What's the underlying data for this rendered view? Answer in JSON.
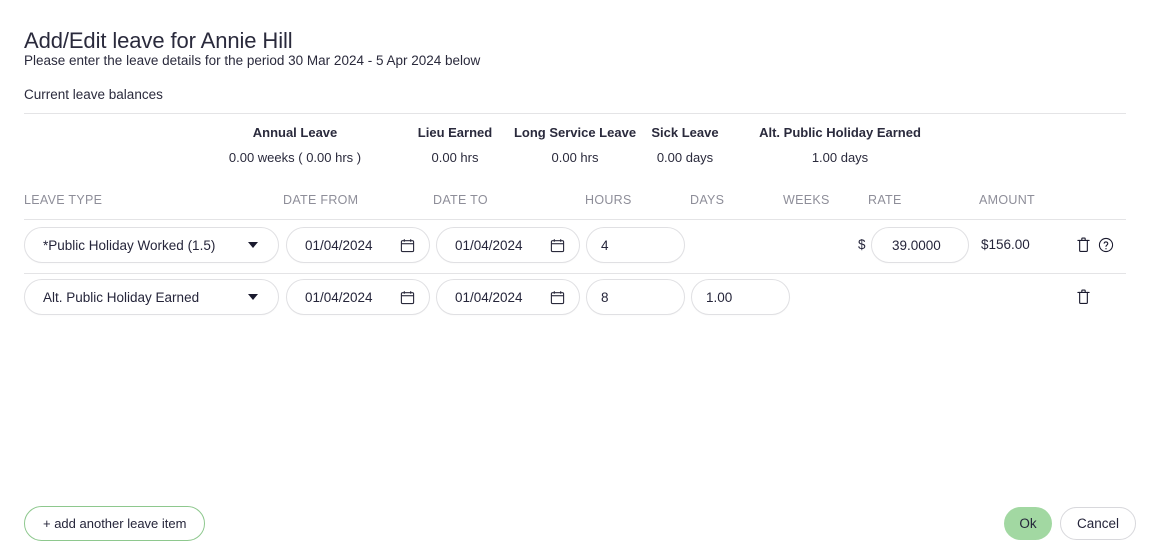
{
  "header": {
    "title": "Add/Edit leave for Annie Hill",
    "subtitle": "Please enter the leave details for the period 30 Mar 2024 - 5 Apr 2024 below",
    "balances_title": "Current leave balances"
  },
  "balances": [
    {
      "label": "Annual Leave",
      "value": "0.00 weeks ( 0.00 hrs )"
    },
    {
      "label": "Lieu Earned",
      "value": "0.00 hrs"
    },
    {
      "label": "Long Service Leave",
      "value": "0.00 hrs"
    },
    {
      "label": "Sick Leave",
      "value": "0.00 days"
    },
    {
      "label": "Alt. Public Holiday Earned",
      "value": "1.00 days"
    }
  ],
  "table": {
    "columns": {
      "leave_type": "LEAVE TYPE",
      "date_from": "DATE FROM",
      "date_to": "DATE TO",
      "hours": "HOURS",
      "days": "DAYS",
      "weeks": "WEEKS",
      "rate": "RATE",
      "amount": "AMOUNT"
    },
    "rows": [
      {
        "leave_type": "*Public Holiday Worked (1.5)",
        "date_from": "01/04/2024",
        "date_to": "01/04/2024",
        "hours": "4",
        "days": "",
        "weeks": "",
        "currency_symbol": "$",
        "rate": "39.0000",
        "amount": "$156.00",
        "delete_icon": "trash-icon",
        "help_icon": "help-circle-icon"
      },
      {
        "leave_type": "Alt. Public Holiday Earned",
        "date_from": "01/04/2024",
        "date_to": "01/04/2024",
        "hours": "8",
        "days": "1.00",
        "weeks": "",
        "currency_symbol": "",
        "rate": "",
        "amount": "",
        "delete_icon": "trash-icon",
        "help_icon": ""
      }
    ]
  },
  "footer": {
    "add_label": "+ add another leave item",
    "ok_label": "Ok",
    "cancel_label": "Cancel"
  },
  "colors": {
    "accent_green": "#a2d8a2",
    "add_border_green": "#8ec88e",
    "text": "#25253a",
    "muted": "#8e8e99",
    "divider": "#e4e4e6",
    "field_border": "#e0e0e3"
  },
  "icons": {
    "calendar": "calendar-icon",
    "caret": "chevron-down-icon",
    "trash": "trash-icon",
    "help": "help-circle-icon"
  }
}
